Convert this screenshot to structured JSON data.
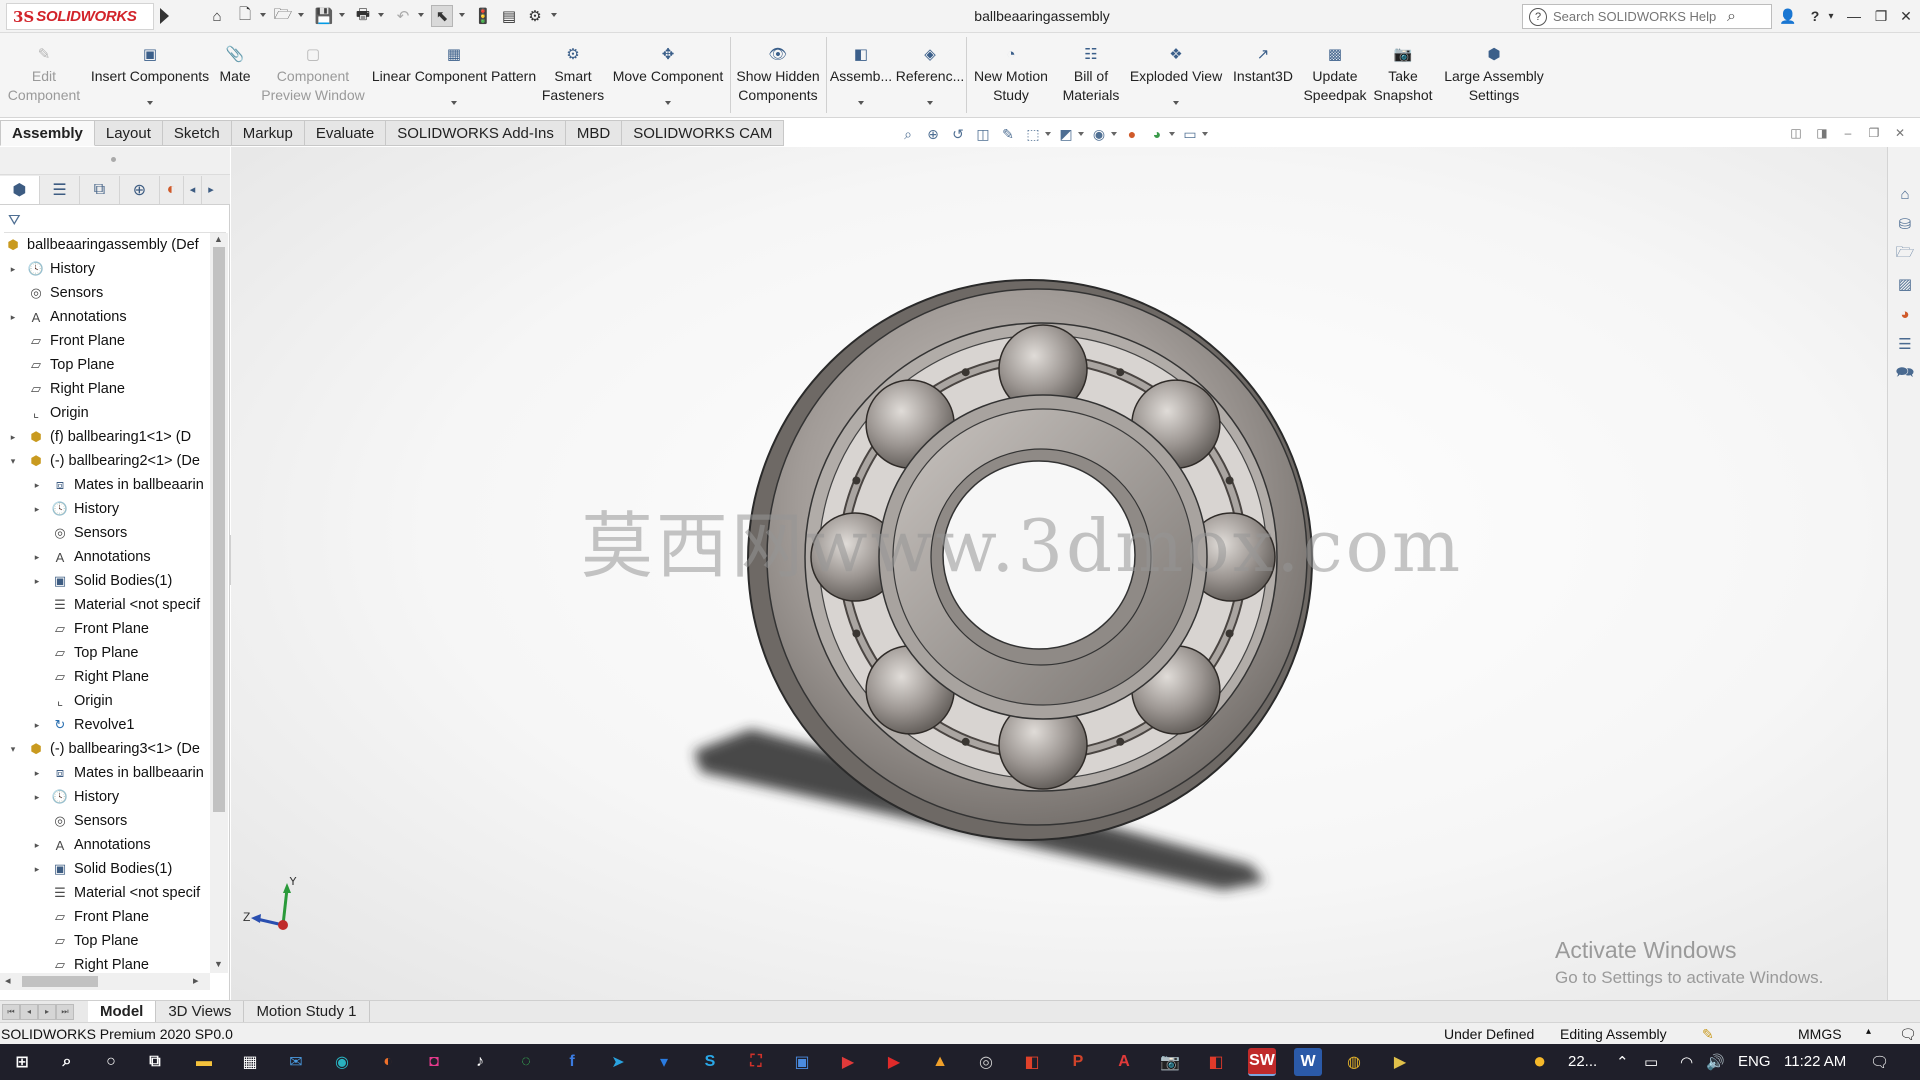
{
  "app": {
    "logo_prefix": "3S",
    "logo_text": "SOLIDWORKS",
    "document_title": "ballbeaaringassembly"
  },
  "search": {
    "placeholder": "Search SOLIDWORKS Help"
  },
  "ribbon": {
    "edit_component": "Edit\nComponent",
    "insert_components": "Insert Components",
    "mate": "Mate",
    "component_preview_window": "Component\nPreview Window",
    "linear_component_pattern": "Linear Component Pattern",
    "smart_fasteners": "Smart\nFasteners",
    "move_component": "Move Component",
    "show_hidden_components": "Show Hidden\nComponents",
    "assembly_features": "Assemb...",
    "reference_geometry": "Referenc...",
    "new_motion_study": "New Motion\nStudy",
    "bill_of_materials": "Bill of\nMaterials",
    "exploded_view": "Exploded View",
    "instant3d": "Instant3D",
    "update_speedpak": "Update\nSpeedpak",
    "take_snapshot": "Take\nSnapshot",
    "large_assembly_settings": "Large Assembly\nSettings"
  },
  "command_tabs": [
    "Assembly",
    "Layout",
    "Sketch",
    "Markup",
    "Evaluate",
    "SOLIDWORKS Add-Ins",
    "MBD",
    "SOLIDWORKS CAM"
  ],
  "tree": {
    "root": "ballbeaaringassembly  (Def",
    "items": [
      "History",
      "Sensors",
      "Annotations",
      "Front Plane",
      "Top Plane",
      "Right Plane",
      "Origin",
      "(f) ballbearing1<1> (D",
      "(-) ballbearing2<1> (De",
      "Mates in ballbeaarin",
      "History",
      "Sensors",
      "Annotations",
      "Solid Bodies(1)",
      "Material <not specif",
      "Front Plane",
      "Top Plane",
      "Right Plane",
      "Origin",
      "Revolve1",
      "(-) ballbearing3<1> (De",
      "Mates in ballbeaarin",
      "History",
      "Sensors",
      "Annotations",
      "Solid Bodies(1)",
      "Material <not specif",
      "Front Plane",
      "Top Plane",
      "Right Plane"
    ]
  },
  "graphics": {
    "watermark": "莫西网www.3dmox.com",
    "activate_title": "Activate Windows",
    "activate_sub": "Go to Settings to activate Windows.",
    "triad_y": "Y",
    "triad_z": "Z"
  },
  "bottom_tabs": [
    "Model",
    "3D Views",
    "Motion Study 1"
  ],
  "status": {
    "product": "SOLIDWORKS Premium 2020 SP0.0",
    "defined": "Under Defined",
    "mode": "Editing Assembly",
    "units": "MMGS"
  },
  "taskbar": {
    "weather": "22...",
    "language": "ENG",
    "time": "11:22 AM",
    "active_app_label": "SW"
  },
  "colors": {
    "brand": "#d2232a",
    "bearing_metal": "#8f8985",
    "bearing_light": "#c4bfbb",
    "taskbar": "#1f1f2a"
  }
}
